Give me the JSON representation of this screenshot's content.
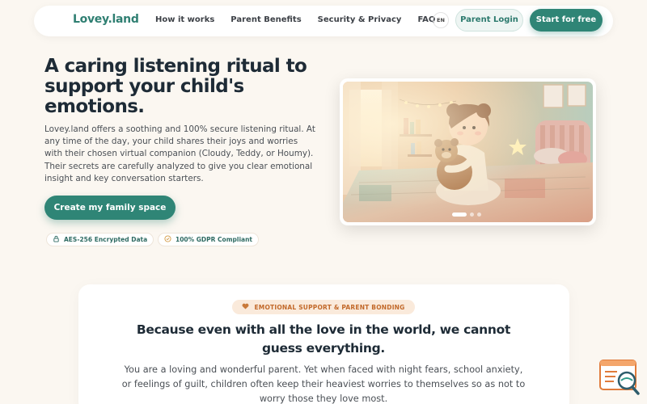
{
  "nav": {
    "logo": "Lovey.land",
    "links": [
      "How it works",
      "Parent Benefits",
      "Security & Privacy",
      "FAQ"
    ],
    "lang": "EN",
    "parent_login": "Parent Login",
    "start_free": "Start for free"
  },
  "hero": {
    "title": "A caring listening ritual to support your child's emotions.",
    "description": "Lovey.land offers a soothing and 100% secure listening ritual. At any time of the day, your child shares their joys and worries with their chosen virtual companion (Cloudy, Teddy, or Houmy). Their secrets are carefully analyzed to give you clear emotional insight and key conversation starters.",
    "cta": "Create my family space",
    "badges": [
      {
        "label": "AES-256 Encrypted Data",
        "icon": "lock-icon"
      },
      {
        "label": "100% GDPR Compliant",
        "icon": "shield-check-icon"
      }
    ],
    "slider": {
      "total": 3,
      "active": 0
    }
  },
  "section": {
    "pill": "EMOTIONAL SUPPORT & PARENT BONDING",
    "pill_icon": "heart-icon",
    "title": "Because even with all the love in the world, we cannot guess everything.",
    "text": "You are a loving and wonderful parent. Yet when faced with night fears, school anxiety, or feelings of guilt, children often keep their heaviest worries to themselves so as not to worry those they love most."
  },
  "colors": {
    "brand": "#2f8576",
    "background": "#fbf7f1",
    "accent_orange": "#c2692a",
    "heading": "#1e2b36"
  },
  "help_widget_icon": "search-document-icon"
}
